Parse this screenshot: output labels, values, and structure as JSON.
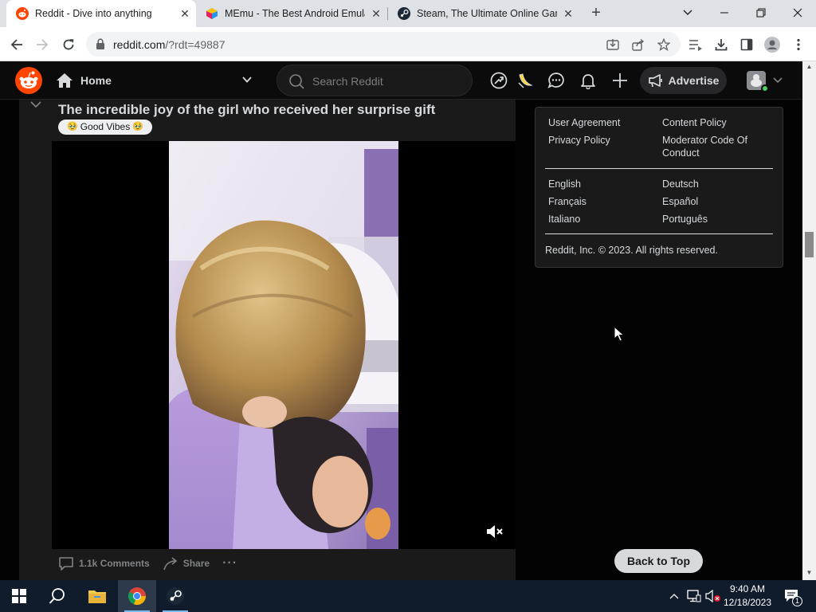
{
  "browser": {
    "tabs": [
      {
        "title": "Reddit - Dive into anything",
        "active": true,
        "icon": "reddit-icon"
      },
      {
        "title": "MEmu - The Best Android Emulat",
        "active": false,
        "icon": "memu-icon"
      },
      {
        "title": "Steam, The Ultimate Online Gam",
        "active": false,
        "icon": "steam-icon"
      }
    ],
    "url_host": "reddit.com",
    "url_path": "/?rdt=49887"
  },
  "header": {
    "home_label": "Home",
    "search_placeholder": "Search Reddit",
    "advertise_label": "Advertise"
  },
  "post": {
    "title": "The incredible joy of the girl who received her surprise gift",
    "flair": "Good Vibes",
    "flair_emoji": "🥹",
    "comments_label": "1.1k Comments",
    "share_label": "Share",
    "more_label": "···"
  },
  "footer": {
    "links_left": [
      "User Agreement",
      "Privacy Policy"
    ],
    "links_right": [
      "Content Policy",
      "Moderator Code Of Conduct"
    ],
    "languages_left": [
      "English",
      "Français",
      "Italiano"
    ],
    "languages_right": [
      "Deutsch",
      "Español",
      "Português"
    ],
    "copyright": "Reddit, Inc. © 2023. All rights reserved."
  },
  "back_to_top_label": "Back to Top",
  "taskbar": {
    "time": "9:40 AM",
    "date": "12/18/2023",
    "notification_count": "1"
  },
  "colors": {
    "reddit_orange": "#ff4500",
    "page_bg": "#030303",
    "card_bg": "#1a1a1b",
    "text_primary": "#d7dadc"
  }
}
